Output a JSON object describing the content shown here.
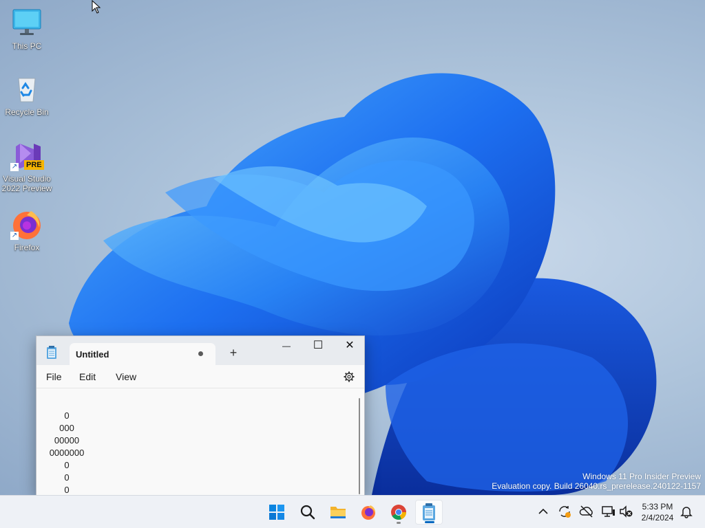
{
  "desktop": {
    "icons": [
      {
        "label": "This PC",
        "icon": "monitor-icon"
      },
      {
        "label": "Recycle Bin",
        "icon": "recycle-bin-icon"
      },
      {
        "label": "Visual Studio 2022 Preview",
        "badge": "PRE",
        "icon": "visual-studio-icon"
      },
      {
        "label": "Firefox",
        "icon": "firefox-icon"
      }
    ],
    "watermark": {
      "line1": "Windows 11 Pro Insider Preview",
      "line2": "Evaluation copy. Build 26040.rs_prerelease.240122-1157"
    }
  },
  "notepad": {
    "tab_title": "Untitled",
    "new_tab": "+",
    "controls": {
      "minimize": "—",
      "maximize": "☐",
      "close": "✕"
    },
    "menu": {
      "file": "File",
      "edit": "Edit",
      "view": "View"
    },
    "content_lines": [
      "0",
      "000",
      "00000",
      "0000000",
      "0",
      "0",
      "0"
    ]
  },
  "taskbar": {
    "apps": [
      "windows-start-icon",
      "search-icon",
      "file-explorer-icon",
      "firefox-icon",
      "chrome-icon",
      "notepad-icon"
    ],
    "clock": {
      "time": "5:33 PM",
      "date": "2/4/2024"
    }
  },
  "colors": {
    "accent": "#0067c0",
    "bloom": "#1f6fe8"
  }
}
